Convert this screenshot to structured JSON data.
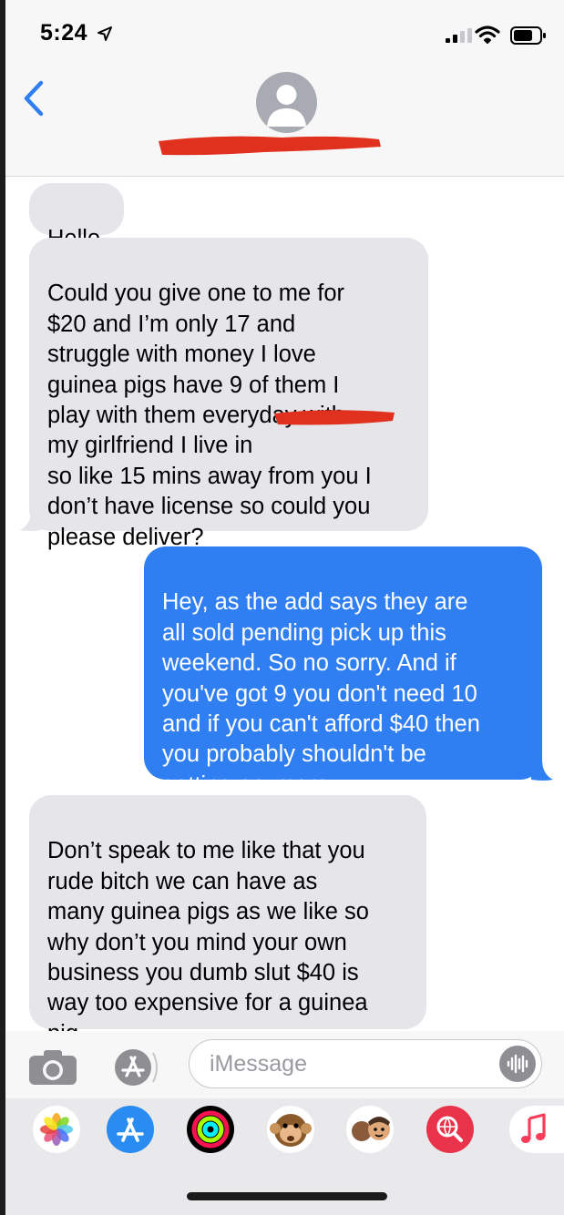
{
  "status_bar": {
    "time": "5:24"
  },
  "messages": [
    {
      "direction": "incoming",
      "text": "Hello"
    },
    {
      "direction": "incoming",
      "text": "Could you give one to me for\n$20 and I’m only 17 and\nstruggle with money I love\nguinea pigs have 9 of them I\nplay with them everyday with\nmy girlfriend I live in\nso like 15 mins away from you I\ndon’t have license so could you\nplease deliver?"
    },
    {
      "direction": "outgoing",
      "text": "Hey, as the add says they are\nall sold pending pick up this\nweekend. So no sorry. And if\nyou've got 9 you don't need 10\nand if you can't afford $40 then\nyou probably shouldn't be\ngetting anymore."
    },
    {
      "direction": "incoming",
      "text": "Don’t speak to me like that you\nrude bitch we can have as\nmany guinea pigs as we like so\nwhy don’t you mind your own\nbusiness you dumb slut $40 is\nway too expensive for a guinea\npig"
    }
  ],
  "composer": {
    "placeholder": "iMessage"
  },
  "app_drawer": [
    {
      "icon": "photos-icon"
    },
    {
      "icon": "app-store-icon"
    },
    {
      "icon": "activity-icon"
    },
    {
      "icon": "animoji-monkey-icon"
    },
    {
      "icon": "memoji-icon"
    },
    {
      "icon": "web-search-icon"
    },
    {
      "icon": "music-icon"
    }
  ],
  "colors": {
    "outgoing_bubble": "#2f7ff2",
    "incoming_bubble": "#e5e5ea",
    "accent": "#2f7ff2",
    "redaction": "#e0301e"
  }
}
